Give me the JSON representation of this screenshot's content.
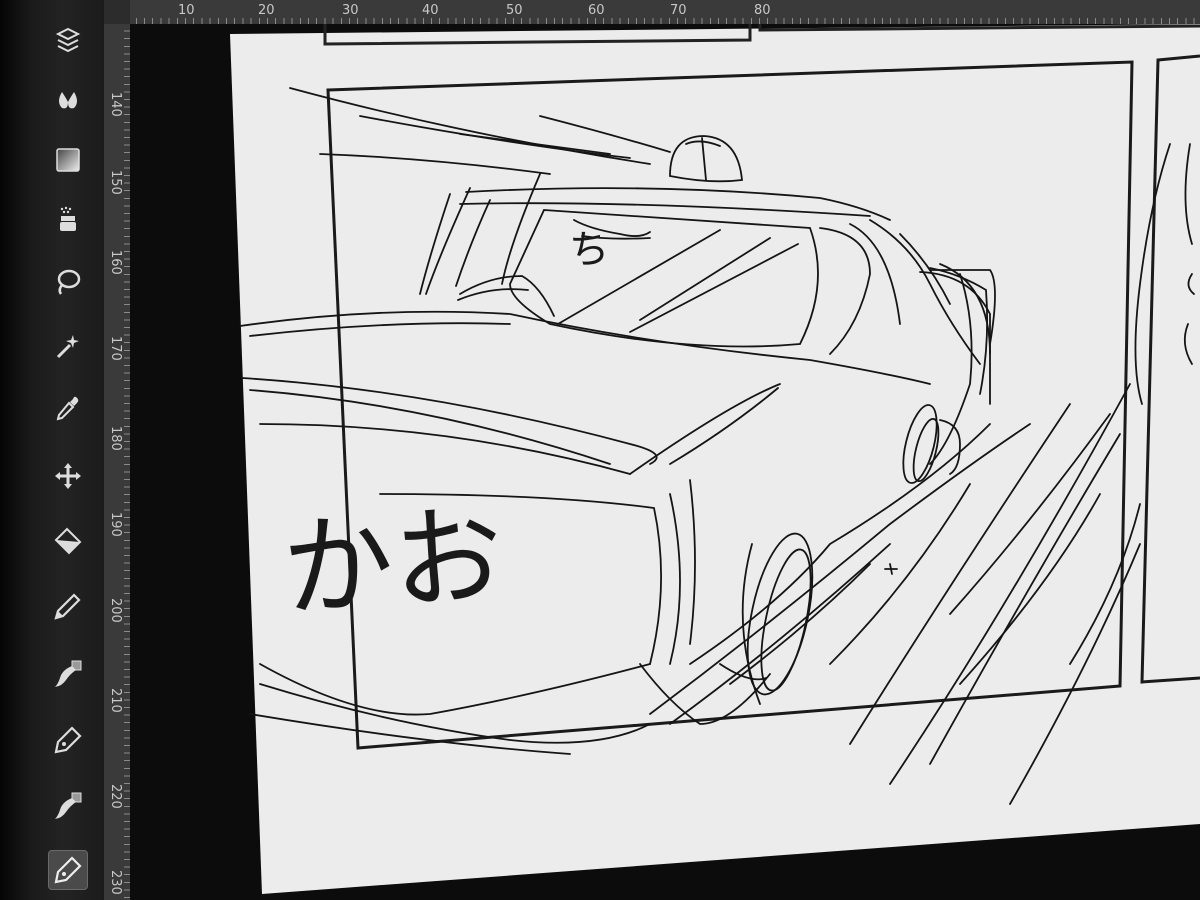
{
  "app": {
    "ui": "manga-drawing-app",
    "accent": "#ffffff",
    "toolbar_bg": "#1f1f1f"
  },
  "toolbar": {
    "tools": [
      {
        "id": "layer-move",
        "icon": "layer-stack-icon",
        "active": false
      },
      {
        "id": "blend",
        "icon": "drop-blend-icon",
        "active": false
      },
      {
        "id": "gradient",
        "icon": "gradient-icon",
        "active": false
      },
      {
        "id": "airbrush",
        "icon": "airbrush-icon",
        "active": false
      },
      {
        "id": "lasso",
        "icon": "lasso-icon",
        "active": false
      },
      {
        "id": "magic-wand",
        "icon": "magic-wand-icon",
        "active": false
      },
      {
        "id": "eyedropper",
        "icon": "eyedropper-icon",
        "active": false
      },
      {
        "id": "move",
        "icon": "move-arrows-icon",
        "active": false
      },
      {
        "id": "fill",
        "icon": "paint-bucket-icon",
        "active": false
      },
      {
        "id": "pencil",
        "icon": "pencil-icon",
        "active": false
      },
      {
        "id": "brush-a",
        "icon": "brush-icon",
        "active": false
      },
      {
        "id": "pen",
        "icon": "pen-nib-icon",
        "active": false
      },
      {
        "id": "brush-b",
        "icon": "brush-icon",
        "active": false
      },
      {
        "id": "pen-active",
        "icon": "pen-nib-icon",
        "active": true
      }
    ]
  },
  "rulers": {
    "horizontal": [
      "10",
      "20",
      "30",
      "40",
      "50",
      "60",
      "70",
      "80"
    ],
    "vertical": [
      "140",
      "150",
      "160",
      "170",
      "180",
      "190",
      "200",
      "210",
      "220",
      "230"
    ]
  },
  "canvas": {
    "sketch_text": "かお",
    "sketch_note": "ち"
  }
}
